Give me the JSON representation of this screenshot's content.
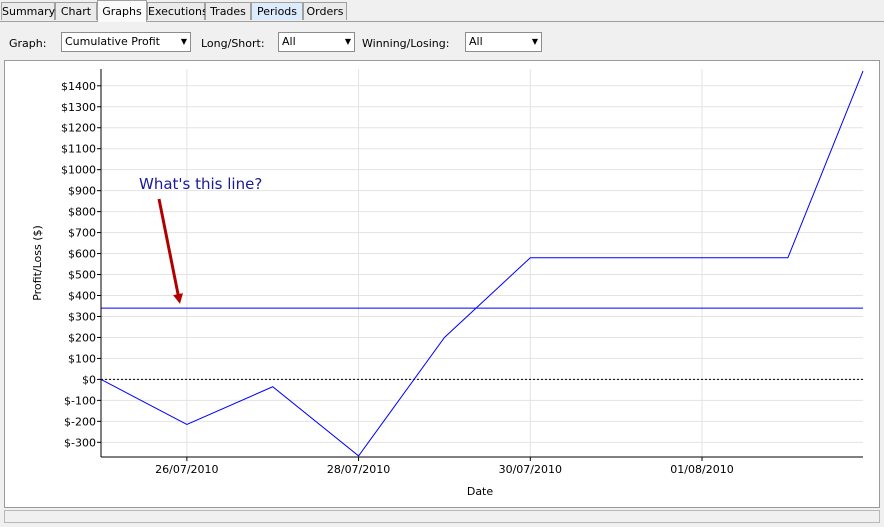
{
  "tabs": [
    {
      "label": "Summary",
      "active": false,
      "highlight": false
    },
    {
      "label": "Chart",
      "active": false,
      "highlight": false
    },
    {
      "label": "Graphs",
      "active": true,
      "highlight": false
    },
    {
      "label": "Executions",
      "active": false,
      "highlight": false
    },
    {
      "label": "Trades",
      "active": false,
      "highlight": false
    },
    {
      "label": "Periods",
      "active": false,
      "highlight": true
    },
    {
      "label": "Orders",
      "active": false,
      "highlight": false
    }
  ],
  "filters": {
    "graph_label": "Graph:",
    "graph_value": "Cumulative Profit",
    "longshort_label": "Long/Short:",
    "longshort_value": "All",
    "winlose_label": "Winning/Losing:",
    "winlose_value": "All"
  },
  "annotation": {
    "text": "What's this line?",
    "arrow_color": "#b00000"
  },
  "chart_data": {
    "type": "line",
    "xlabel": "Date",
    "ylabel": "Profit/Loss ($)",
    "ylim": [
      -370,
      1480
    ],
    "yticks": [
      -300,
      -200,
      -100,
      0,
      100,
      200,
      300,
      400,
      500,
      600,
      700,
      800,
      900,
      1000,
      1100,
      1200,
      1300,
      1400
    ],
    "ytick_labels": [
      "$-300",
      "$-200",
      "$-100",
      "$0",
      "$100",
      "$200",
      "$300",
      "$400",
      "$500",
      "$600",
      "$700",
      "$800",
      "$900",
      "$1000",
      "$1100",
      "$1200",
      "$1300",
      "$1400"
    ],
    "xlim": [
      "25/07/2010",
      "02/08/2010 21:00"
    ],
    "xtick_labels": [
      "26/07/2010",
      "28/07/2010",
      "30/07/2010",
      "01/08/2010"
    ],
    "grid": true,
    "series": [
      {
        "color": "#0000ff",
        "points": [
          {
            "x": "25/07/2010 00:00",
            "y": 0
          },
          {
            "x": "26/07/2010 00:00",
            "y": -215
          },
          {
            "x": "27/07/2010 00:00",
            "y": -35
          },
          {
            "x": "28/07/2010 00:00",
            "y": -365
          },
          {
            "x": "29/07/2010 00:00",
            "y": 200
          },
          {
            "x": "30/07/2010 00:00",
            "y": 580
          },
          {
            "x": "01/08/2010 00:00",
            "y": 580
          },
          {
            "x": "02/08/2010 00:00",
            "y": 580
          },
          {
            "x": "02/08/2010 21:00",
            "y": 1470
          }
        ]
      }
    ],
    "reference_lines": [
      {
        "y": 340,
        "color": "#0000ff",
        "style": "solid"
      },
      {
        "y": 0,
        "color": "#000000",
        "style": "dashed"
      }
    ]
  }
}
